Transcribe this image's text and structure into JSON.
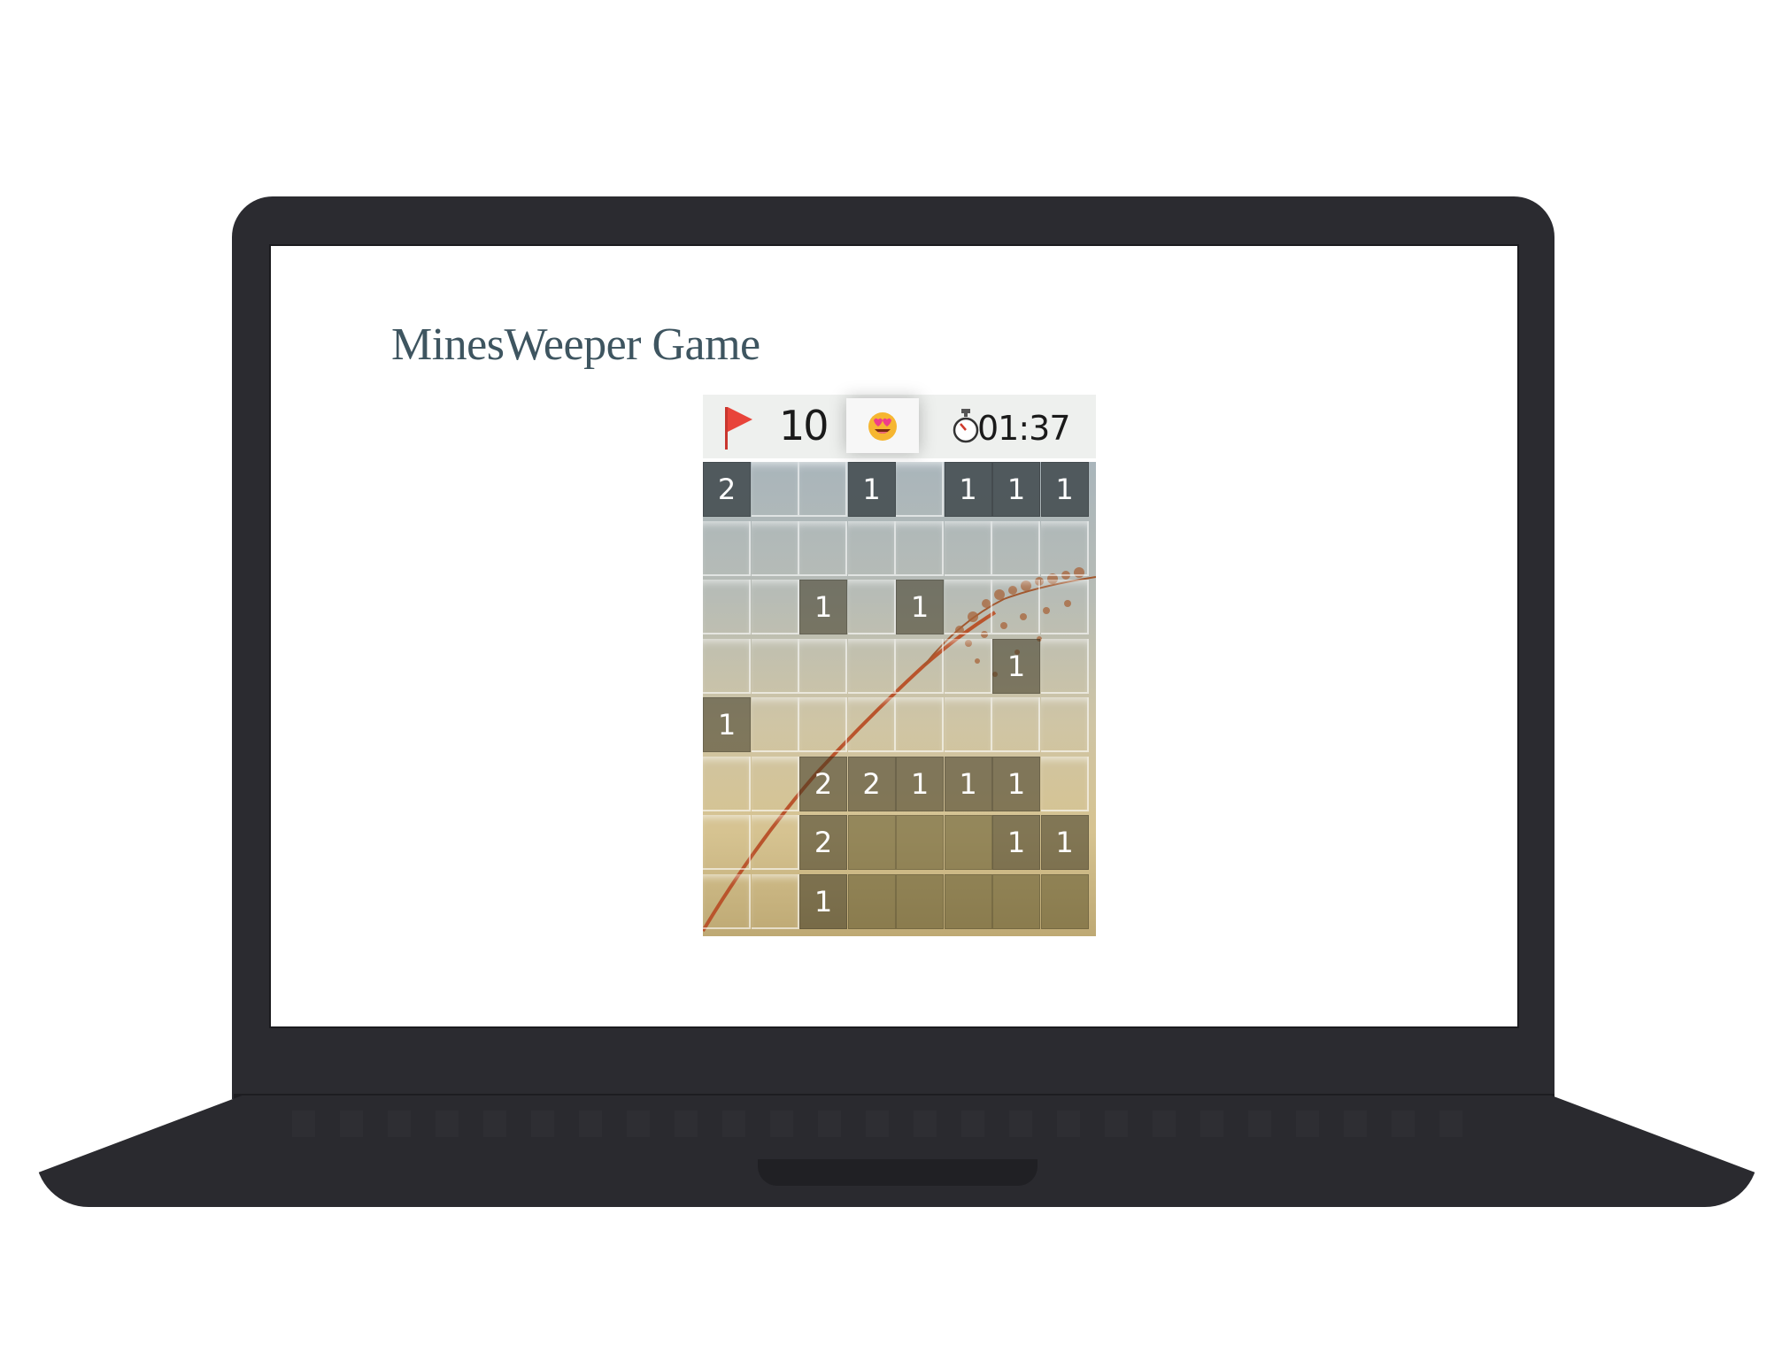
{
  "page": {
    "title": "MinesWeeper Game"
  },
  "status": {
    "flags_remaining": "10",
    "face_icon": "heart-eyes-smiley-icon",
    "timer": "01:37"
  },
  "colors": {
    "flag": "#e8443a",
    "title": "#3e5560",
    "header_bg": "#eef0ee"
  },
  "board": {
    "rows": 8,
    "cols": 8,
    "cells": [
      [
        "2",
        "",
        "",
        "1",
        "",
        "1",
        "1",
        "1"
      ],
      [
        "",
        "",
        "",
        "",
        "",
        "",
        "",
        ""
      ],
      [
        "",
        "",
        "1",
        "",
        "1",
        "",
        "",
        ""
      ],
      [
        "",
        "",
        "",
        "",
        "",
        "",
        "1",
        ""
      ],
      [
        "1",
        "",
        "",
        "",
        "",
        "",
        "",
        ""
      ],
      [
        "",
        "",
        "2",
        "2",
        "1",
        "1",
        "1",
        ""
      ],
      [
        "",
        "",
        "2",
        "",
        "",
        "",
        "1",
        "1"
      ],
      [
        "",
        "",
        "1",
        "",
        "",
        "",
        "",
        ""
      ]
    ],
    "revealed": [
      [
        1,
        0,
        0,
        1,
        0,
        1,
        1,
        1
      ],
      [
        0,
        0,
        0,
        0,
        0,
        0,
        0,
        0
      ],
      [
        0,
        0,
        1,
        0,
        1,
        0,
        0,
        0
      ],
      [
        0,
        0,
        0,
        0,
        0,
        0,
        1,
        0
      ],
      [
        1,
        0,
        0,
        0,
        0,
        0,
        0,
        0
      ],
      [
        0,
        0,
        1,
        1,
        1,
        1,
        1,
        0
      ],
      [
        0,
        0,
        1,
        1,
        1,
        1,
        1,
        1
      ],
      [
        0,
        0,
        1,
        1,
        1,
        1,
        1,
        1
      ]
    ]
  }
}
